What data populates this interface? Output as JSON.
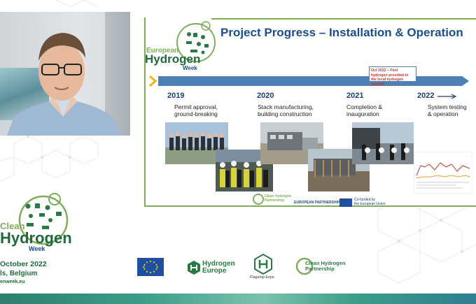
{
  "slide": {
    "title": "Project Progress – Installation & Operation",
    "logo": {
      "line1": "European",
      "line2": "Hydrogen",
      "line3": "Week"
    },
    "callout": "Oct 2022 – First hydrogen provided to the local hydrogen network",
    "milestones": [
      {
        "year": "2019",
        "text_line1": "Permit approval,",
        "text_line2": "ground-breaking"
      },
      {
        "year": "2020",
        "text_line1": "Stack manufacturing,",
        "text_line2": "building construction"
      },
      {
        "year": "2021",
        "text_line1": "Completion &",
        "text_line2": "inauguration"
      },
      {
        "year": "2022",
        "text_line1": "System testing",
        "text_line2": "& operation"
      }
    ],
    "footer": {
      "partnership_line1": "Clean Hydrogen",
      "partnership_line2": "Partnership",
      "european_partnership": "EUROPEAN PARTNERSHIP",
      "cofunded_line1": "Co-funded by",
      "cofunded_line2": "the European Union"
    }
  },
  "event": {
    "logo": {
      "line1": "Clean",
      "line2": "Hydrogen",
      "line3": "Week"
    },
    "date": "October 2022",
    "city": "ls, Belgium",
    "website": "enweek.eu"
  },
  "partners": {
    "hydrogen_europe_line1": "Hydrogen",
    "hydrogen_europe_line2": "Europe",
    "flagship_expo": "Flagship Expo",
    "chp_line1": "Clean Hydrogen",
    "chp_line2": "Partnership"
  },
  "colors": {
    "title_blue": "#1b4e8c",
    "timeline_blue": "#4e7fb6",
    "green_dark": "#1f6b3c",
    "green_light": "#7fae5a",
    "callout_red": "#c0392b"
  },
  "icons": [
    "chevron-right-icon",
    "arrow-right-icon",
    "eu-flag-icon",
    "hexagon-logo-icon"
  ]
}
